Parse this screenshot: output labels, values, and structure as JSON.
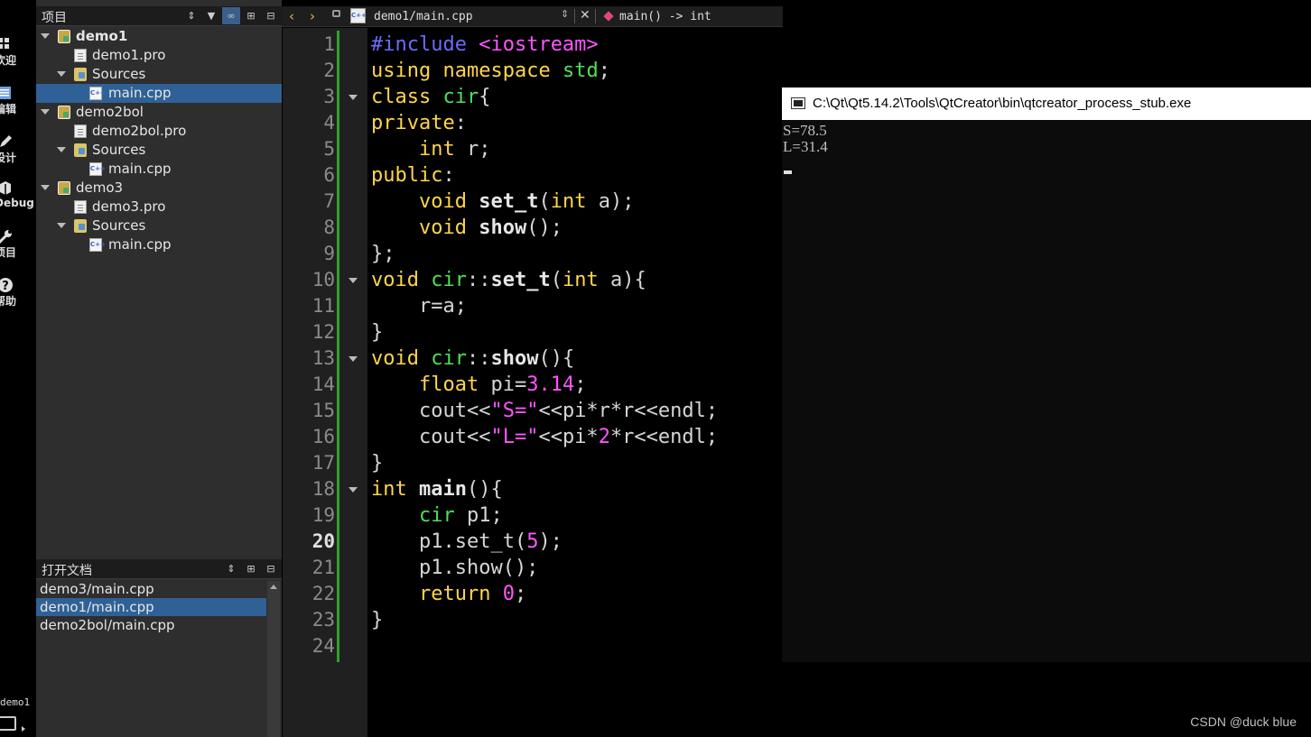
{
  "modebar": {
    "items": [
      {
        "label": "欢迎",
        "icon": "grid-icon"
      },
      {
        "label": "编辑",
        "icon": "edit-icon"
      },
      {
        "label": "设计",
        "icon": "pencil-icon"
      },
      {
        "label": "Debug",
        "icon": "bug-icon"
      },
      {
        "label": "项目",
        "icon": "wrench-icon"
      },
      {
        "label": "帮助",
        "icon": "help-icon"
      }
    ],
    "project_name": "demo1"
  },
  "project_panel": {
    "title": "项目",
    "tree": [
      {
        "label": "demo1",
        "type": "project",
        "bold": true
      },
      {
        "label": "demo1.pro",
        "type": "pro-file"
      },
      {
        "label": "Sources",
        "type": "folder"
      },
      {
        "label": "main.cpp",
        "type": "cpp-file",
        "selected": true
      },
      {
        "label": "demo2bol",
        "type": "project"
      },
      {
        "label": "demo2bol.pro",
        "type": "pro-file"
      },
      {
        "label": "Sources",
        "type": "folder"
      },
      {
        "label": "main.cpp",
        "type": "cpp-file"
      },
      {
        "label": "demo3",
        "type": "project"
      },
      {
        "label": "demo3.pro",
        "type": "pro-file"
      },
      {
        "label": "Sources",
        "type": "folder"
      },
      {
        "label": "main.cpp",
        "type": "cpp-file"
      }
    ]
  },
  "open_docs": {
    "title": "打开文档",
    "items": [
      "demo3/main.cpp",
      "demo1/main.cpp",
      "demo2bol/main.cpp"
    ],
    "selected_index": 1
  },
  "editor": {
    "file": "demo1/main.cpp",
    "function": "main() -> int",
    "current_line": 20,
    "lines": [
      "#include <iostream>",
      "using namespace std;",
      "class cir{",
      "private:",
      "    int r;",
      "public:",
      "    void set_t(int a);",
      "    void show();",
      "};",
      "void cir::set_t(int a){",
      "    r=a;",
      "}",
      "void cir::show(){",
      "    float pi=3.14;",
      "    cout<<\"S=\"<<pi*r*r<<endl;",
      "    cout<<\"L=\"<<pi*2*r<<endl;",
      "}",
      "int main(){",
      "    cir p1;",
      "    p1.set_t(5);",
      "    p1.show();",
      "    return 0;",
      "}",
      ""
    ],
    "fold_lines": [
      3,
      10,
      13,
      18
    ]
  },
  "console": {
    "title": "C:\\Qt\\Qt5.14.2\\Tools\\QtCreator\\bin\\qtcreator_process_stub.exe",
    "output": [
      "S=78.5",
      "L=31.4"
    ]
  },
  "watermark": "CSDN @duck blue"
}
